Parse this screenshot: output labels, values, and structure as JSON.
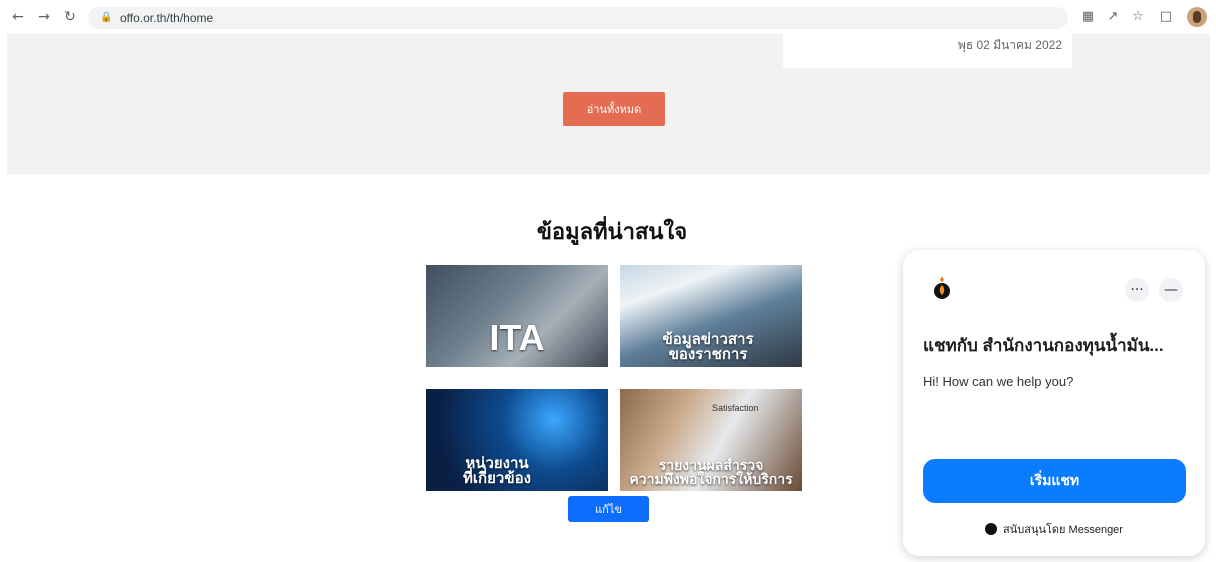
{
  "browser": {
    "url": "offo.or.th/th/home",
    "icons": [
      "back-icon",
      "forward-icon",
      "reload-icon",
      "lock-icon",
      "translate-icon",
      "share-icon",
      "star-icon",
      "sidepanel-icon",
      "profile-avatar"
    ]
  },
  "news": {
    "date": "พุธ 02 มีนาคม 2022",
    "read_all_label": "อ่านทั้งหมด"
  },
  "interest": {
    "heading": "ข้อมูลที่น่าสนใจ",
    "tiles": [
      {
        "caption": "ITA"
      },
      {
        "caption_line1": "ข้อมูลข่าวสาร",
        "caption_line2": "ของราชการ"
      },
      {
        "caption_line1": "หน่วยงาน",
        "caption_line2": "ที่เกี่ยวข้อง"
      },
      {
        "caption_line1": "รายงานผลสำรวจ",
        "caption_line2": "ความพึงพอใจการให้บริการ",
        "image_text": "Satisfaction"
      }
    ],
    "edit_label": "แก้ไข"
  },
  "chat": {
    "title": "แชทกับ สำนักงานกองทุนน้ำมัน...",
    "greeting": "Hi! How can we help you?",
    "start_label": "เริ่มแชท",
    "powered_by": "สนับสนุนโดย Messenger",
    "more_symbol": "···",
    "minimize_symbol": "—",
    "accent_color": "#0a7cff"
  },
  "colors": {
    "read_all_button": "#e36c53",
    "edit_button": "#0d6efd",
    "top_section_bg": "#f3f2f0"
  }
}
